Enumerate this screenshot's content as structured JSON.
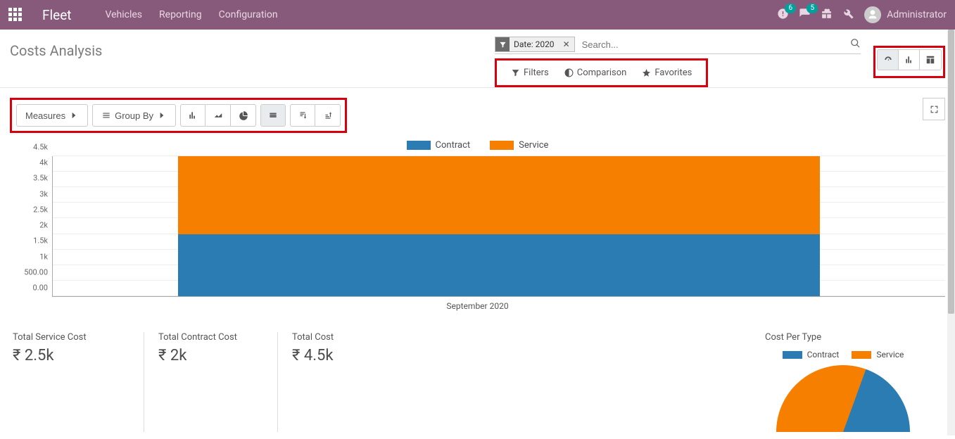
{
  "nav": {
    "brand": "Fleet",
    "items": [
      "Vehicles",
      "Reporting",
      "Configuration"
    ],
    "badge_clock": "6",
    "badge_chat": "5",
    "user": "Administrator"
  },
  "page": {
    "title": "Costs Analysis"
  },
  "search": {
    "facet_label": "Date: 2020",
    "placeholder": "Search...",
    "opts": {
      "filters": "Filters",
      "comparison": "Comparison",
      "favorites": "Favorites"
    }
  },
  "toolbar": {
    "measures": "Measures",
    "groupby": "Group By"
  },
  "chart_data": {
    "type": "bar",
    "stacked": true,
    "categories": [
      "September 2020"
    ],
    "series": [
      {
        "name": "Contract",
        "values": [
          2000
        ],
        "color": "#2b7cb3"
      },
      {
        "name": "Service",
        "values": [
          2500
        ],
        "color": "#f77f00"
      }
    ],
    "ylim": [
      0,
      4500
    ],
    "yticks": [
      0,
      500,
      1000,
      1500,
      2000,
      2500,
      3000,
      3500,
      4000,
      4500
    ],
    "ytick_labels": [
      "0.00",
      "500.00",
      "1k",
      "1.5k",
      "2k",
      "2.5k",
      "3k",
      "3.5k",
      "4k",
      "4.5k"
    ]
  },
  "cards": {
    "service": {
      "title": "Total Service Cost",
      "value": "₹ 2.5k"
    },
    "contract": {
      "title": "Total Contract Cost",
      "value": "₹ 2k"
    },
    "total": {
      "title": "Total Cost",
      "value": "₹ 4.5k"
    }
  },
  "cpt": {
    "title": "Cost Per Type",
    "legend": [
      {
        "name": "Contract",
        "color": "#2b7cb3"
      },
      {
        "name": "Service",
        "color": "#f77f00"
      }
    ]
  }
}
